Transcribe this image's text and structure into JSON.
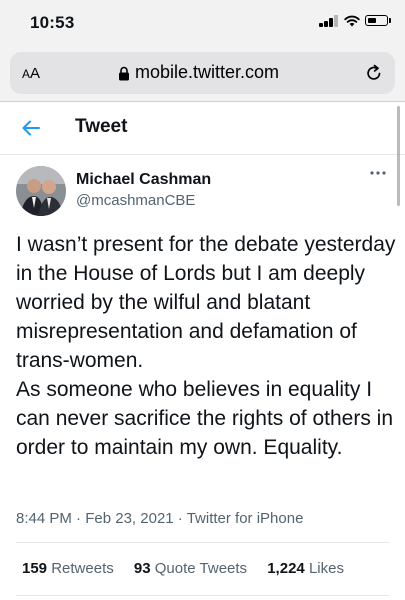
{
  "status_bar": {
    "time": "10:53"
  },
  "browser": {
    "text_size_label_small": "A",
    "text_size_label_large": "A",
    "url": "mobile.twitter.com"
  },
  "header": {
    "title": "Tweet"
  },
  "tweet": {
    "author_name": "Michael Cashman",
    "author_handle": "@mcashmanCBE",
    "text": "I wasn’t present for the debate yesterday in the House of Lords but I am deeply worried by the wilful and blatant misrepresentation and defamation of trans-women.\nAs someone who believes in equality I can never sacrifice the rights of others in order to maintain my own. Equality.",
    "time": "8:44 PM",
    "date": "Feb 23, 2021",
    "source": "Twitter for iPhone",
    "separator": "·"
  },
  "stats": {
    "retweets_count": "159",
    "retweets_label": "Retweets",
    "quotes_count": "93",
    "quotes_label": "Quote Tweets",
    "likes_count": "1,224",
    "likes_label": "Likes"
  },
  "colors": {
    "accent": "#1d9bf0",
    "secondary_text": "#536471",
    "primary_text": "#0f1419"
  },
  "icons": [
    "signal-icon",
    "wifi-icon",
    "battery-icon",
    "lock-icon",
    "reload-icon",
    "back-arrow-icon",
    "more-icon"
  ]
}
